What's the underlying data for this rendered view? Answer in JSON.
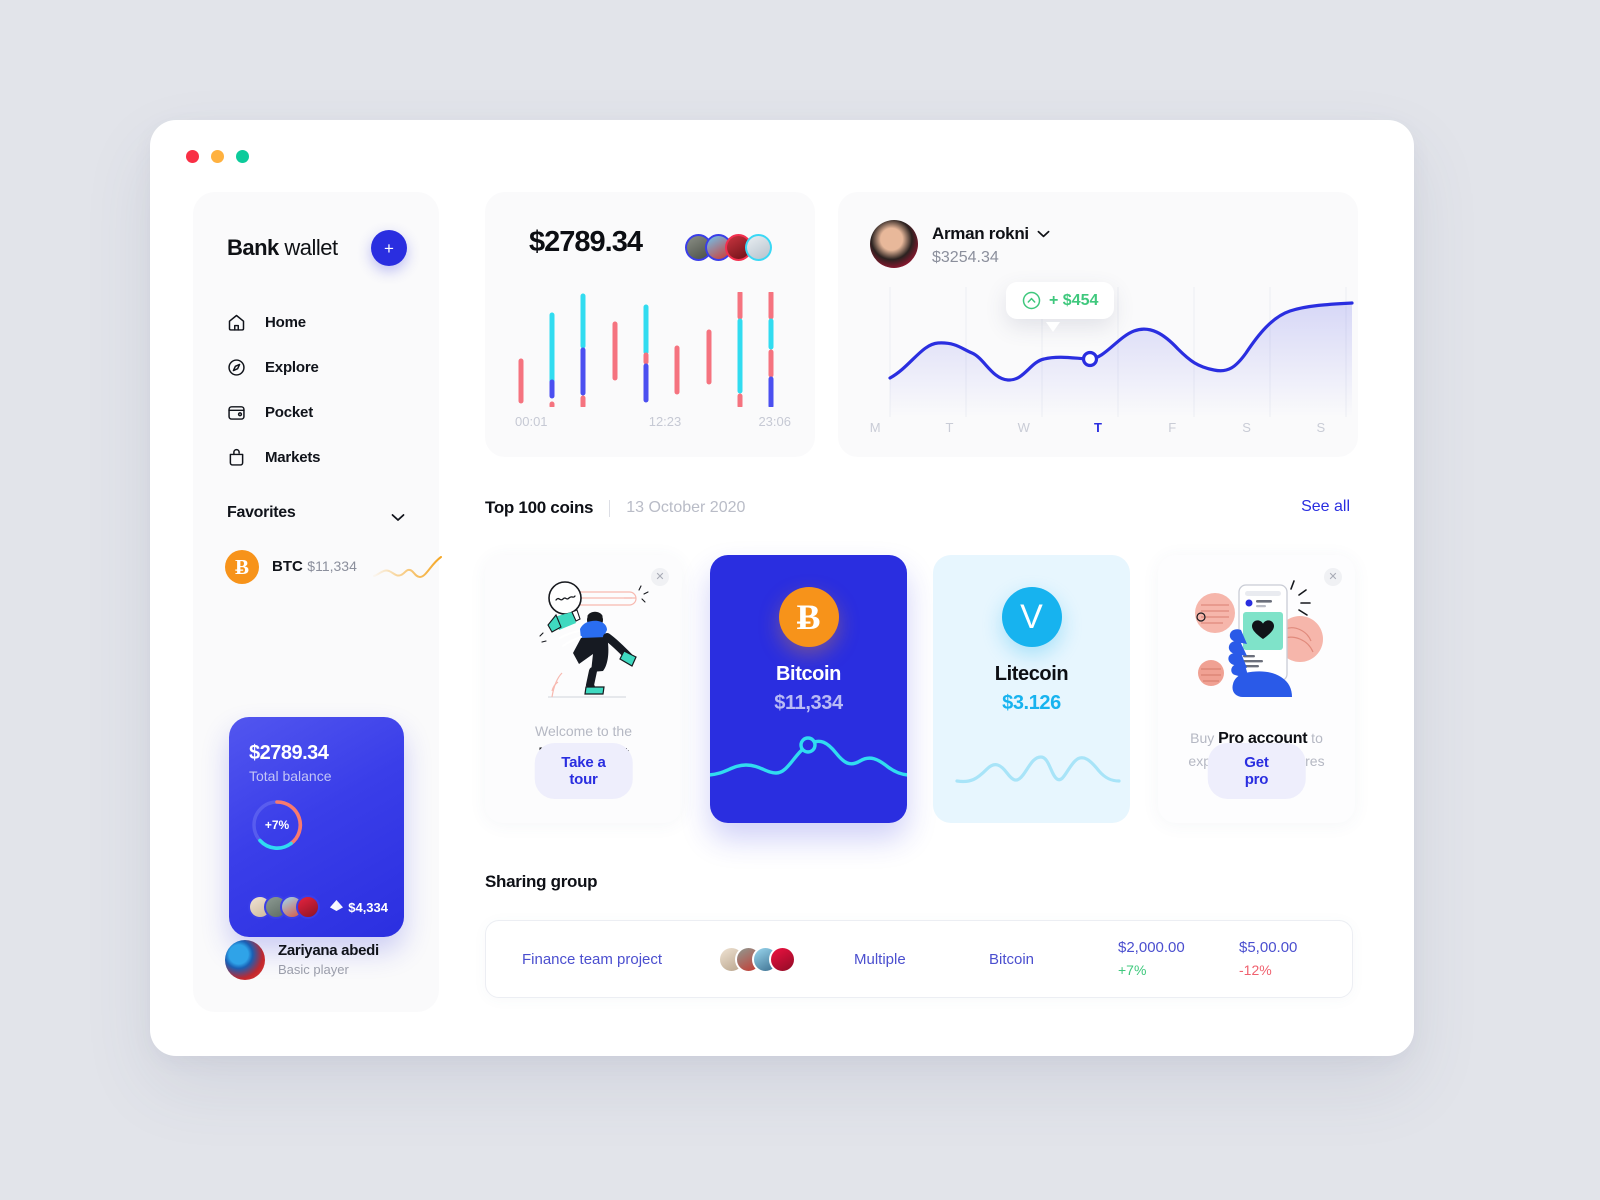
{
  "window": {
    "traffic_lights": [
      "close",
      "minimize",
      "maximize"
    ]
  },
  "sidebar": {
    "brand_bold": "Bank",
    "brand_light": " wallet",
    "add_label": "+",
    "items": [
      {
        "label": "Home",
        "icon": "home-icon"
      },
      {
        "label": "Explore",
        "icon": "compass-icon"
      },
      {
        "label": "Pocket",
        "icon": "wallet-icon"
      },
      {
        "label": "Markets",
        "icon": "bag-icon"
      }
    ],
    "favorites": {
      "title": "Favorites",
      "coin_symbol": "BTC",
      "coin_mark": "Ƀ",
      "coin_price": "$11,334"
    },
    "balance_card": {
      "amount": "$2789.34",
      "subtitle": "Total balance",
      "change": "+7%",
      "eth_amount": "$4,334"
    },
    "profile": {
      "name": "Zariyana abedi",
      "role": "Basic player"
    }
  },
  "candle_card": {
    "amount": "$2789.34",
    "axis": [
      "00:01",
      "12:23",
      "23:06"
    ]
  },
  "line_card": {
    "name": "Arman rokni",
    "balance": "$3254.34",
    "tooltip": "+ $454",
    "days": [
      "M",
      "T",
      "W",
      "T",
      "F",
      "S",
      "S"
    ],
    "active_day_index": 3
  },
  "section": {
    "title": "Top 100 coins",
    "date": "13 October 2020",
    "see_all": "See all"
  },
  "coin_cards": {
    "welcome": {
      "top": "Welcome to the",
      "bottom": "Bank wallet",
      "button": "Take a tour"
    },
    "bitcoin": {
      "name": "Bitcoin",
      "price": "$11,334",
      "mark": "Ƀ"
    },
    "litecoin": {
      "name": "Litecoin",
      "price": "$3.126",
      "mark": "V"
    },
    "pro": {
      "prefix": "Buy ",
      "strong": "Pro account",
      "suffix": " to",
      "line2": "explore more features",
      "button": "Get pro"
    }
  },
  "sharing": {
    "title": "Sharing group",
    "row": {
      "name": "Finance team project",
      "members": "Multiple",
      "coin": "Bitcoin",
      "value1": "$2,000.00",
      "change1": "+7%",
      "value2": "$5,00.00",
      "change2": "-12%"
    }
  },
  "chart_data": [
    {
      "type": "bar",
      "name": "candlestick-ohlc",
      "title": "$2789.34",
      "xlabel": "",
      "ylabel": "",
      "xticks": [
        "00:01",
        "12:23",
        "23:06"
      ],
      "colors": {
        "up": "#31dcf0",
        "down": "#f5737f",
        "mid": "#4b4ff0"
      },
      "bars": [
        {
          "x": 0,
          "segments": [
            {
              "color": "down",
              "top": 60,
              "bottom": 95
            }
          ]
        },
        {
          "x": 1,
          "segments": [
            {
              "color": "up",
              "top": 20,
              "bottom": 78
            },
            {
              "color": "mid",
              "top": 78,
              "bottom": 90
            },
            {
              "color": "down",
              "top": 93,
              "bottom": 100
            }
          ]
        },
        {
          "x": 2,
          "segments": [
            {
              "color": "up",
              "top": 3,
              "bottom": 47
            },
            {
              "color": "mid",
              "top": 50,
              "bottom": 88
            },
            {
              "color": "down",
              "top": 92,
              "bottom": 100
            }
          ]
        },
        {
          "x": 3,
          "segments": [
            {
              "color": "down",
              "top": 28,
              "bottom": 75
            }
          ]
        },
        {
          "x": 4,
          "segments": [
            {
              "color": "up",
              "top": 13,
              "bottom": 52
            },
            {
              "color": "down",
              "top": 55,
              "bottom": 61
            },
            {
              "color": "mid",
              "top": 64,
              "bottom": 94
            }
          ]
        },
        {
          "x": 5,
          "segments": [
            {
              "color": "down",
              "top": 49,
              "bottom": 87
            }
          ]
        },
        {
          "x": 6,
          "segments": [
            {
              "color": "down",
              "top": 35,
              "bottom": 78
            }
          ]
        },
        {
          "x": 7,
          "segments": [
            {
              "color": "down",
              "top": 0,
              "bottom": 22
            },
            {
              "color": "up",
              "top": 25,
              "bottom": 86
            },
            {
              "color": "down",
              "top": 90,
              "bottom": 100
            }
          ]
        },
        {
          "x": 8,
          "segments": [
            {
              "color": "down",
              "top": 0,
              "bottom": 22
            },
            {
              "color": "up",
              "top": 25,
              "bottom": 48
            },
            {
              "color": "down",
              "top": 52,
              "bottom": 72
            },
            {
              "color": "mid",
              "top": 75,
              "bottom": 100
            }
          ]
        }
      ]
    },
    {
      "type": "area",
      "name": "weekly-balance-line",
      "title": "Arman rokni",
      "xlabel": "",
      "ylabel": "",
      "categories": [
        "M",
        "T",
        "W",
        "T",
        "F",
        "S",
        "S"
      ],
      "values": [
        28,
        62,
        22,
        48,
        72,
        30,
        92
      ],
      "ylim": [
        0,
        100
      ],
      "grid": true,
      "legend": "none",
      "line_color": "#2a2ee0",
      "marker": {
        "day": "T",
        "label": "+ $454"
      }
    },
    {
      "type": "line",
      "name": "btc-sparkline",
      "values": [
        30,
        36,
        28,
        52,
        34,
        40,
        26,
        78
      ],
      "line_color": "#f5a623"
    },
    {
      "type": "line",
      "name": "bitcoin-card-wave",
      "values": [
        38,
        44,
        58,
        42,
        72,
        48,
        60,
        40,
        50
      ],
      "line_color": "#31dcf0"
    },
    {
      "type": "line",
      "name": "litecoin-card-wave",
      "values": [
        34,
        38,
        56,
        34,
        62,
        36,
        64,
        46,
        40
      ],
      "line_color": "#a8e4f8"
    }
  ]
}
